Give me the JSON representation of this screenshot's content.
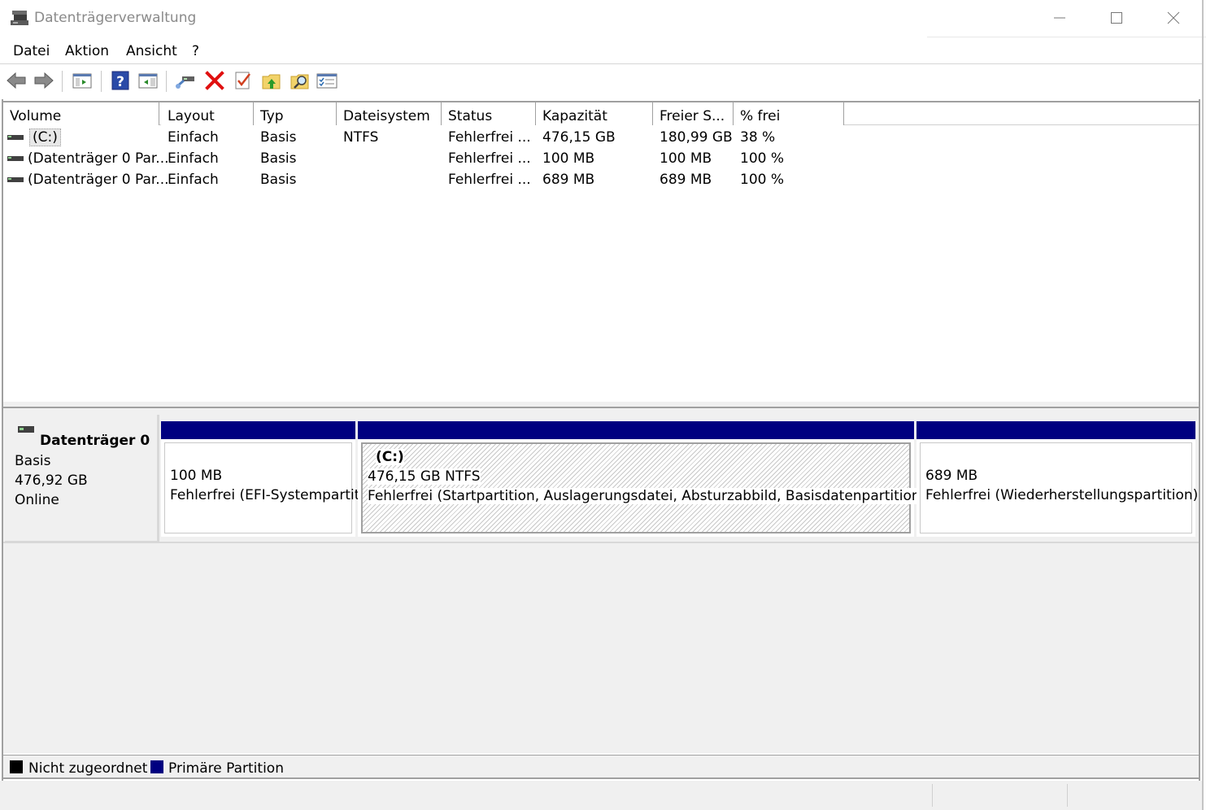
{
  "window": {
    "title": "Datenträgerverwaltung"
  },
  "menu": {
    "items": [
      "Datei",
      "Aktion",
      "Ansicht",
      "?"
    ]
  },
  "toolbar": {
    "buttons": [
      "back-arrow-icon",
      "forward-arrow-icon",
      "console-tree-icon",
      "help-icon",
      "properties-pane-icon",
      "connect-drive-icon",
      "delete-icon",
      "checkmark-document-icon",
      "folder-up-icon",
      "folder-search-icon",
      "settings-list-icon"
    ],
    "delete_color": "#e01010"
  },
  "volume_list": {
    "columns": [
      "Volume",
      "Layout",
      "Typ",
      "Dateisystem",
      "Status",
      "Kapazität",
      "Freier S...",
      "% frei"
    ],
    "rows": [
      {
        "volume": "(C:)",
        "layout": "Einfach",
        "typ": "Basis",
        "dateisystem": "NTFS",
        "status": "Fehlerfrei ...",
        "kapazitaet": "476,15 GB",
        "frei": "180,99 GB",
        "prozent": "38 %"
      },
      {
        "volume": "(Datenträger 0 Par...",
        "layout": "Einfach",
        "typ": "Basis",
        "dateisystem": "",
        "status": "Fehlerfrei ...",
        "kapazitaet": "100 MB",
        "frei": "100 MB",
        "prozent": "100 %"
      },
      {
        "volume": "(Datenträger 0 Par...",
        "layout": "Einfach",
        "typ": "Basis",
        "dateisystem": "",
        "status": "Fehlerfrei ...",
        "kapazitaet": "689 MB",
        "frei": "689 MB",
        "prozent": "100 %"
      }
    ]
  },
  "disk": {
    "name": "Datenträger 0",
    "type": "Basis",
    "size": "476,92 GB",
    "state": "Online",
    "partitions": [
      {
        "title": "",
        "size": "100 MB",
        "status": "Fehlerfrei (EFI-Systempartit"
      },
      {
        "title": "(C:)",
        "size": "476,15 GB NTFS",
        "status": "Fehlerfrei (Startpartition, Auslagerungsdatei, Absturzabbild, Basisdatenpartition)"
      },
      {
        "title": "",
        "size": "689 MB",
        "status": "Fehlerfrei (Wiederherstellungspartition)"
      }
    ],
    "partition_bar_color": "#000080"
  },
  "legend": {
    "items": [
      {
        "label": "Nicht zugeordnet",
        "color": "#000000"
      },
      {
        "label": "Primäre Partition",
        "color": "#000080"
      }
    ]
  }
}
